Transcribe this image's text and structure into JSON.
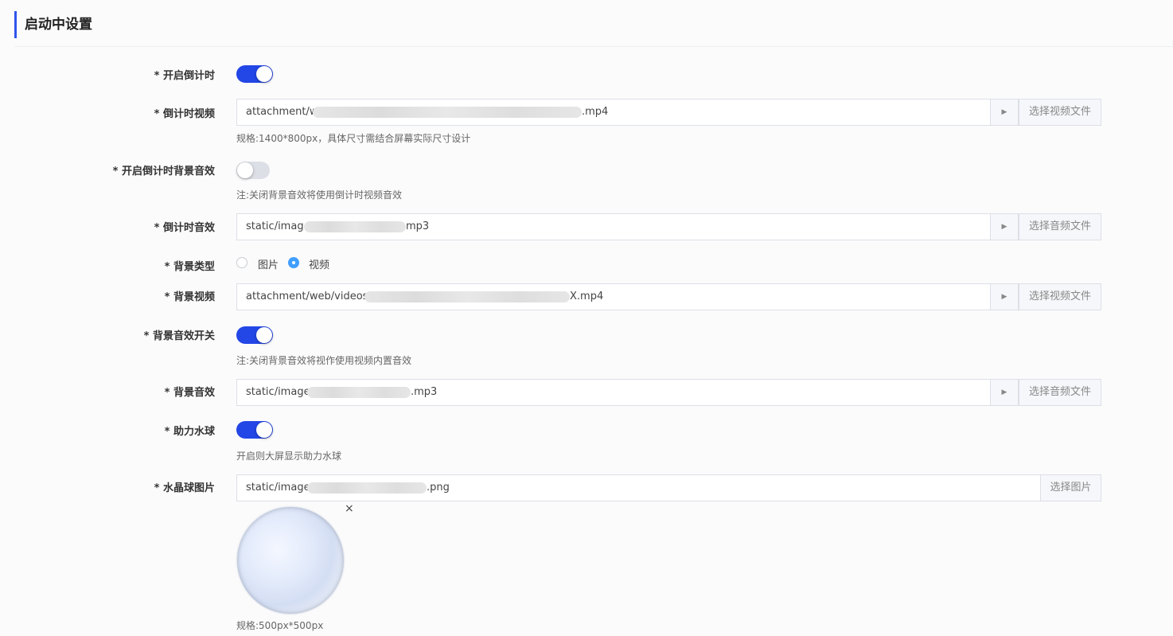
{
  "section": {
    "title": "启动中设置"
  },
  "countdown_switch": {
    "label": "* 开启倒计时",
    "on": true
  },
  "countdown_video": {
    "label": "* 倒计时视频",
    "prefix": "attachment/web",
    "suffix": ".mp4",
    "play_icon": "▶",
    "button": "选择视频文件",
    "hint": "规格:1400*800px，具体尺寸需结合屏幕实际尺寸设计"
  },
  "countdown_bg_audio_switch": {
    "label": "* 开启倒计时背景音效",
    "on": false,
    "hint": "注:关闭背景音效将使用倒计时视频音效"
  },
  "countdown_audio": {
    "label": "* 倒计时音效",
    "prefix": "static/image",
    "suffix": "mp3",
    "play_icon": "▶",
    "button": "选择音频文件"
  },
  "bg_type": {
    "label": "* 背景类型",
    "options": [
      "图片",
      "视频"
    ],
    "selected": "视频"
  },
  "bg_video": {
    "label": "* 背景视频",
    "prefix": "attachment/web/videos/0/",
    "suffix": "X.mp4",
    "play_icon": "▶",
    "button": "选择视频文件"
  },
  "bg_audio_switch": {
    "label": "* 背景音效开关",
    "on": true,
    "hint": "注:关闭背景音效将视作使用视频内置音效"
  },
  "bg_audio": {
    "label": "* 背景音效",
    "prefix": "static/images",
    "suffix": ".mp3",
    "play_icon": "▶",
    "button": "选择音频文件"
  },
  "water_ball_switch": {
    "label": "* 助力水球",
    "on": true,
    "hint": "开启则大屏显示助力水球"
  },
  "crystal_image": {
    "label": "* 水晶球图片",
    "prefix": "static/images",
    "suffix": ".png",
    "button": "选择图片",
    "close_icon": "×",
    "hint": "规格:500px*500px"
  },
  "colors": {
    "accent": "#2346e6",
    "radio": "#409eff"
  }
}
